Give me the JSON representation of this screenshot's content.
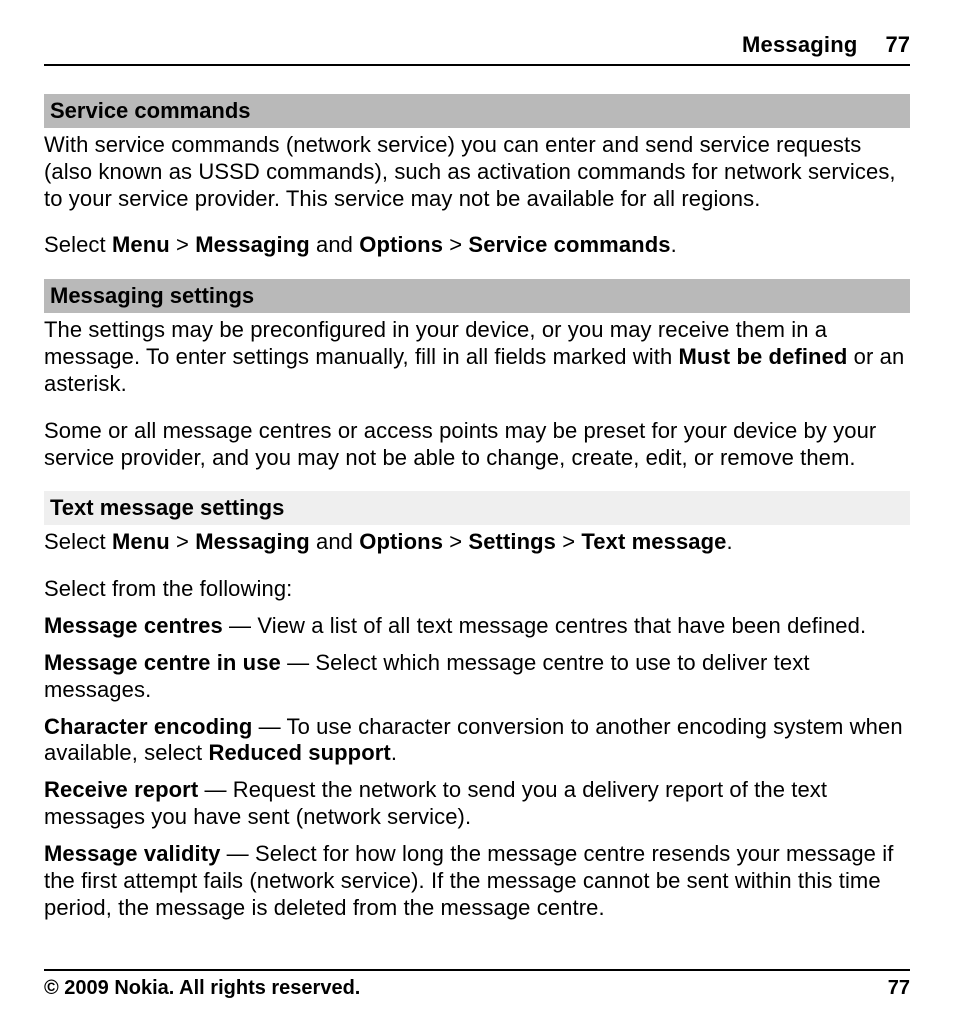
{
  "header": {
    "section": "Messaging",
    "page": "77"
  },
  "s1": {
    "title": "Service commands",
    "p1": "With service commands (network service) you can enter and send service requests (also known as USSD commands), such as activation commands for network services, to your service provider. This service may not be available for all regions.",
    "nav": {
      "pre": "Select ",
      "menu": "Menu",
      "gt1": " > ",
      "messaging": "Messaging",
      "and": " and ",
      "options": "Options",
      "gt2": " > ",
      "sc": "Service commands",
      "dot": "."
    }
  },
  "s2": {
    "title": "Messaging settings",
    "p1a": "The settings may be preconfigured in your device, or you may receive them in a message. To enter settings manually, fill in all fields marked with ",
    "mbd": "Must be defined",
    "p1b": " or an asterisk.",
    "p2": "Some or all message centres or access points may be preset for your device by your service provider, and you may not be able to change, create, edit, or remove them."
  },
  "s3": {
    "title": "Text message settings",
    "nav": {
      "pre": "Select ",
      "menu": "Menu",
      "gt1": " > ",
      "messaging": "Messaging",
      "and": " and ",
      "options": "Options",
      "gt2": " > ",
      "settings": "Settings",
      "gt3": " > ",
      "tm": "Text message",
      "dot": "."
    },
    "intro": "Select from the following:",
    "items": {
      "mc_l": "Message centres",
      "mc_t": "  — View a list of all text message centres that have been defined.",
      "mciu_l": "Message centre in use",
      "mciu_t": "  — Select which message centre to use to deliver text messages.",
      "ce_l": "Character encoding",
      "ce_t1": "  — To use character conversion to another encoding system when available, select ",
      "ce_b": "Reduced support",
      "ce_t2": ".",
      "rr_l": "Receive report",
      "rr_t": "  — Request the network to send you a delivery report of the text messages you have sent (network service).",
      "mv_l": "Message validity",
      "mv_t": "  — Select for how long the message centre resends your message if the first attempt fails (network service). If the message cannot be sent within this time period, the message is deleted from the message centre."
    }
  },
  "footer": {
    "copyright": "© 2009 Nokia. All rights reserved.",
    "page": "77"
  }
}
